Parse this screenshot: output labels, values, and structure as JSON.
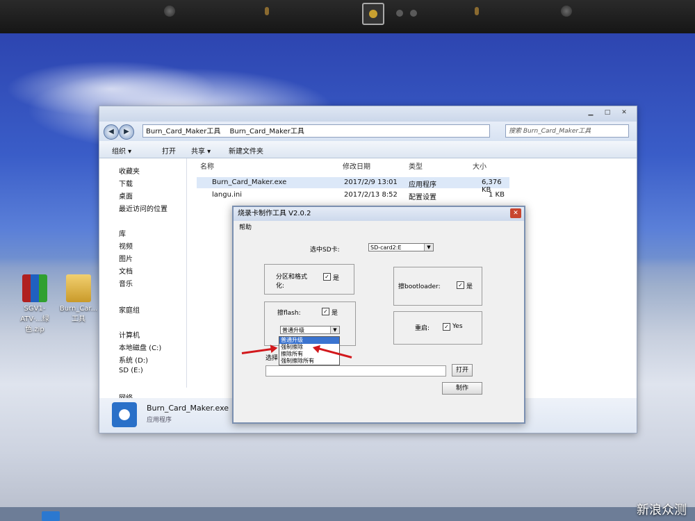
{
  "explorer": {
    "breadcrumb": [
      "Burn_Card_Maker工具",
      "Burn_Card_Maker工具"
    ],
    "search_placeholder": "搜索 Burn_Card_Maker工具",
    "toolbar": {
      "organize": "组织 ▾",
      "open": "打开",
      "share": "共享 ▾",
      "new_folder": "新建文件夹"
    },
    "nav": {
      "favorites": "收藏夹",
      "downloads": "下载",
      "desktop": "桌面",
      "recent": "最近访问的位置",
      "library": "库",
      "videos": "视频",
      "pictures": "图片",
      "documents": "文档",
      "music": "音乐",
      "homegroup": "家庭组",
      "computer": "计算机",
      "drive_c": "本地磁盘 (C:)",
      "drive_d": "系统 (D:)",
      "drive_e": "SD (E:)",
      "network": "网络"
    },
    "columns": {
      "name": "名称",
      "date": "修改日期",
      "type": "类型",
      "size": "大小"
    },
    "files": [
      {
        "name": "Burn_Card_Maker.exe",
        "date": "2017/2/9 13:01",
        "type": "应用程序",
        "size": "6,376 KB"
      },
      {
        "name": "langu.ini",
        "date": "2017/2/13 8:52",
        "type": "配置设置",
        "size": "1 KB"
      }
    ],
    "details": {
      "name": "Burn_Card_Maker.exe",
      "type": "应用程序"
    }
  },
  "dialog": {
    "title": "烧录卡制作工具 V2.0.2",
    "menu_help": "帮助",
    "select_sd_label": "选中SD卡:",
    "select_sd_value": "SD-card2:E",
    "partition_label": "分区和格式化:",
    "partition_yes": "是",
    "bootloader_label": "擦bootloader:",
    "bootloader_yes": "是",
    "flash_label": "擦flash:",
    "flash_yes": "是",
    "flash_mode_value": "普通升级",
    "flash_options": [
      "普通升级",
      "强制擦除",
      "擦除所有",
      "强制擦除所有"
    ],
    "restart_label": "重启:",
    "restart_value": "Yes",
    "choose_label": "选择",
    "open_button": "打开",
    "make_button": "制作"
  },
  "desktop": {
    "icon_zip": "SGV1-ATV-...绿色.zip",
    "icon_folder": "Burn_Car...工具"
  },
  "watermark": "新浪众测"
}
